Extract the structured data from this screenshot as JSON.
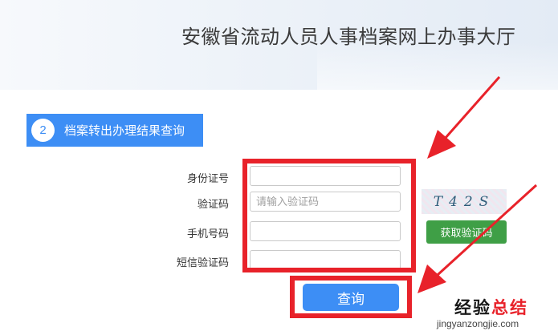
{
  "header": {
    "title": "安徽省流动人员人事档案网上办事大厅"
  },
  "step": {
    "number": "2",
    "title": "档案转出办理结果查询"
  },
  "form": {
    "id_label": "身份证号",
    "id_value": "",
    "captcha_label": "验证码",
    "captcha_placeholder": "请输入验证码",
    "captcha_image_text": "T42S",
    "phone_label": "手机号码",
    "phone_value": "",
    "sms_label": "短信验证码",
    "sms_value": "",
    "sms_button_label": "获取验证码",
    "submit_label": "查询"
  },
  "watermark": {
    "main_part1": "经验",
    "main_part2": "总结",
    "sub": "jingyanzongjie.com"
  },
  "colors": {
    "primary_blue": "#3d8ef5",
    "green_button": "#3f9f46",
    "annotation_red": "#e8222a"
  }
}
